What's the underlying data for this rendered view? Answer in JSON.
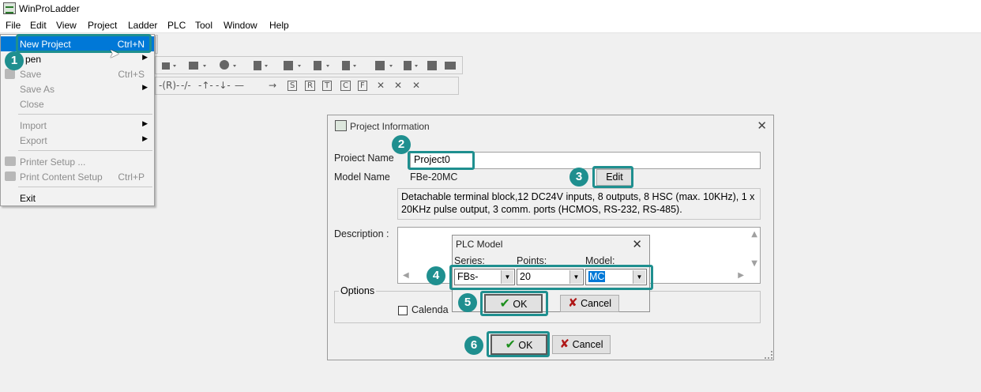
{
  "window": {
    "title": "WinProLadder"
  },
  "menubar": [
    "File",
    "Edit",
    "View",
    "Project",
    "Ladder",
    "PLC",
    "Tool",
    "Window",
    "Help"
  ],
  "file_menu": {
    "new_project": {
      "label": "New Project",
      "shortcut": "Ctrl+N"
    },
    "open": {
      "label": "Open",
      "visible_label": "pen"
    },
    "save": {
      "label": "Save",
      "shortcut": "Ctrl+S"
    },
    "save_as": {
      "label": "Save As"
    },
    "close": {
      "label": "Close"
    },
    "import": {
      "label": "Import"
    },
    "export": {
      "label": "Export"
    },
    "printer_setup": {
      "label": "Printer Setup ..."
    },
    "print_content_setup": {
      "label": "Print Content Setup",
      "shortcut": "Ctrl+P"
    },
    "exit": {
      "label": "Exit"
    }
  },
  "toolbar": {
    "row2": [
      "-(R)-",
      "-/-",
      "-↑-",
      "-↓-",
      "—",
      "→",
      "S",
      "R",
      "T",
      "C",
      "F",
      "✕",
      "✕",
      "✕"
    ]
  },
  "project_dialog": {
    "title": "Project Information",
    "project_name_label": "Proiect Name",
    "project_name_value": "Project0",
    "model_name_label": "Model Name",
    "model_name_value": "FBe-20MC",
    "edit_button": "Edit",
    "model_description": "Detachable terminal block,12 DC24V inputs, 8 outputs, 8 HSC (max. 10KHz), 1 x 20KHz pulse output, 3 comm. ports (HCMOS, RS-232, RS-485).",
    "description_label": "Description :",
    "options_label": "Options",
    "calendar_label": "Calenda",
    "ok_button": "OK",
    "cancel_button": "Cancel"
  },
  "plc_model_dialog": {
    "title": "PLC Model",
    "series_label": "Series:",
    "points_label": "Points:",
    "model_label": "Model:",
    "series_value": "FBs-",
    "points_value": "20",
    "model_value": "MC",
    "ok_button": "OK",
    "cancel_button": "Cancel"
  },
  "callouts": [
    "1",
    "2",
    "3",
    "4",
    "5",
    "6"
  ],
  "colors": {
    "accent_teal": "#1f8f8f",
    "selection_blue": "#0078d7"
  }
}
